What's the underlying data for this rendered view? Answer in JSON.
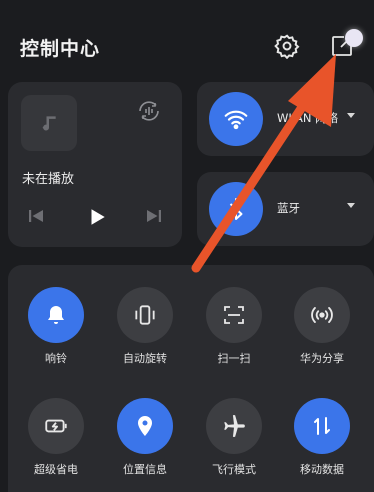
{
  "header": {
    "title": "控制中心",
    "settings_icon": "gear-icon",
    "edit_icon": "edit-icon"
  },
  "media": {
    "status": "未在播放",
    "icons": [
      "music-note-icon",
      "audio-cast-icon",
      "previous-icon",
      "play-icon",
      "next-icon"
    ]
  },
  "connectivity": {
    "wifi": {
      "label": "WLAN 网络",
      "icon": "wifi-icon",
      "active": true
    },
    "bluetooth": {
      "label": "蓝牙",
      "icon": "bluetooth-icon",
      "active": true
    }
  },
  "tiles": [
    {
      "label": "响铃",
      "icon": "bell-icon",
      "active": true
    },
    {
      "label": "自动旋转",
      "icon": "auto-rotate-icon",
      "active": false
    },
    {
      "label": "扫一扫",
      "icon": "scan-icon",
      "active": false
    },
    {
      "label": "华为分享",
      "icon": "share-signal-icon",
      "active": false
    },
    {
      "label": "超级省电",
      "icon": "battery-saver-icon",
      "active": false
    },
    {
      "label": "位置信息",
      "icon": "location-icon",
      "active": true
    },
    {
      "label": "飞行模式",
      "icon": "airplane-icon",
      "active": false
    },
    {
      "label": "移动数据",
      "icon": "mobile-data-icon",
      "active": true
    }
  ],
  "colors": {
    "accent": "#3b75ea",
    "annotation_arrow": "#e8542a",
    "background": "#1b1c1f",
    "card": "#2a2b2f"
  }
}
